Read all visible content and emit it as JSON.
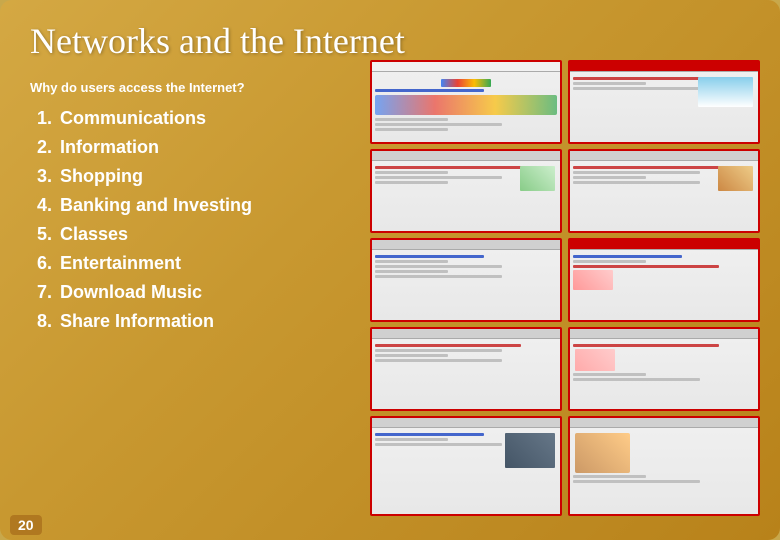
{
  "slide": {
    "title": "Networks and the Internet",
    "subtitle": "Why do users access the Internet?",
    "list_items": [
      {
        "num": "1.",
        "label": "Communications"
      },
      {
        "num": "2.",
        "label": "Information"
      },
      {
        "num": "3.",
        "label": "Shopping"
      },
      {
        "num": "4.",
        "label": "Banking and Investing"
      },
      {
        "num": "5.",
        "label": "Classes"
      },
      {
        "num": "6.",
        "label": "Entertainment"
      },
      {
        "num": "7.",
        "label": "Download Music"
      },
      {
        "num": "8.",
        "label": "Share Information"
      }
    ],
    "page_number": "20"
  }
}
